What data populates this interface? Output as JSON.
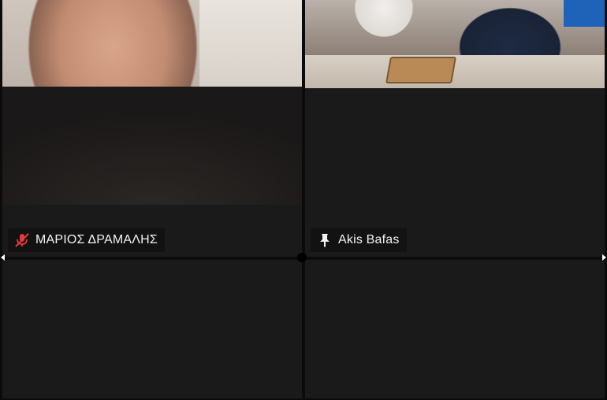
{
  "participants": [
    {
      "name": "ΜΑΡΙΟΣ ΔΡΑΜΑΛΗΣ",
      "status_icon": "muted-mic-icon",
      "status_color": "#e5393b"
    },
    {
      "name": "Akis Bafas",
      "status_icon": "pin-icon",
      "status_color": "#f2f2f2"
    }
  ],
  "colors": {
    "tile_background": "#1a1a1a",
    "gap": "#0b0b0b",
    "name_tag": "#121212"
  }
}
